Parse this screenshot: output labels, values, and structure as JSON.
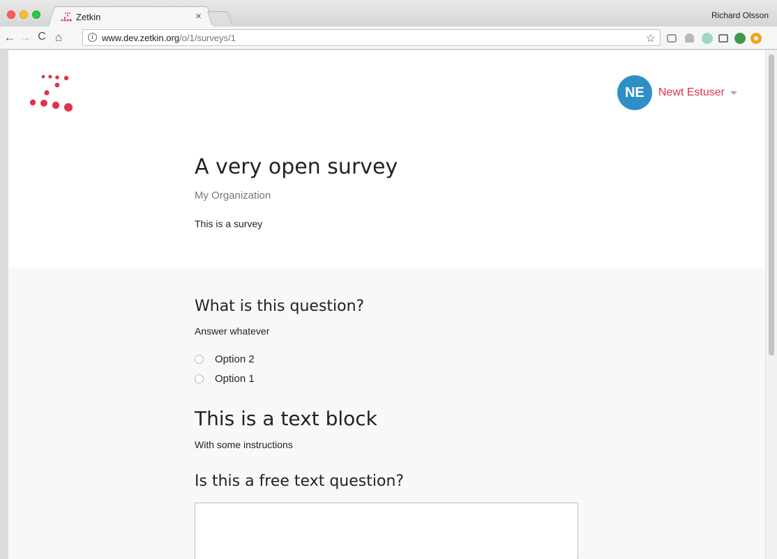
{
  "browser": {
    "tab": {
      "title": "Zetkin",
      "close_glyph": "×"
    },
    "profile_name": "Richard Olsson",
    "address": {
      "host": "www.dev.zetkin.org",
      "path": "/o/1/surveys/1"
    },
    "nav_glyphs": {
      "back": "←",
      "forward": "→",
      "reload": "C",
      "home": "⌂",
      "star": "☆",
      "info": "i"
    },
    "extensions": [
      "camera-icon",
      "drive-icon",
      "globe-icon",
      "cast-icon",
      "refresh-extension-icon",
      "orange-extension-icon"
    ]
  },
  "header": {
    "user": {
      "initials": "NE",
      "name": "Newt Estuser"
    },
    "colors": {
      "accent": "#e2324a",
      "avatar": "#2e8fc6"
    }
  },
  "survey": {
    "title": "A very open survey",
    "organization": "My Organization",
    "info_text": "This is a survey"
  },
  "elements": {
    "question1": {
      "title": "What is this question?",
      "description": "Answer whatever",
      "options": [
        "Option 2",
        "Option 1"
      ]
    },
    "text_block": {
      "title": "This is a text block",
      "content": "With some instructions"
    },
    "question2": {
      "title": "Is this a free text question?",
      "value": ""
    }
  }
}
